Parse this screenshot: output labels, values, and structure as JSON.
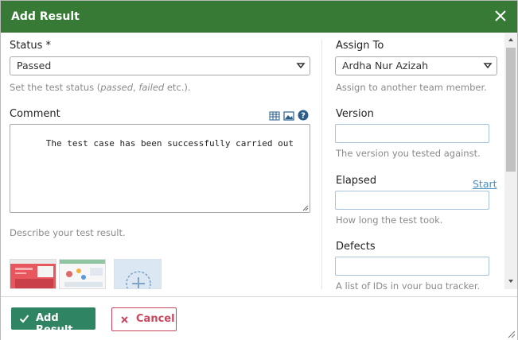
{
  "dialog": {
    "title": "Add Result",
    "close_icon": "close-icon"
  },
  "status": {
    "label": "Status *",
    "value": "Passed",
    "hint_prefix": "Set the test status (",
    "hint_em1": "passed",
    "hint_sep": ", ",
    "hint_em2": "failed",
    "hint_suffix": " etc.)."
  },
  "comment": {
    "label": "Comment",
    "value": "The test case has been successfully carried out",
    "hint": "Describe your test result.",
    "toolbar_icons": [
      "table-icon",
      "image-icon",
      "help-icon"
    ]
  },
  "attachments": {
    "items": [
      "attachment-thumbnail",
      "attachment-thumbnail"
    ],
    "add_icon": "add-attachment-icon"
  },
  "assign_to": {
    "label": "Assign To",
    "value": "Ardha Nur Azizah",
    "hint": "Assign to another team member."
  },
  "version": {
    "label": "Version",
    "value": "",
    "hint": "The version you tested against."
  },
  "elapsed": {
    "label": "Elapsed",
    "start_link": "Start",
    "value": "",
    "hint": "How long the test took."
  },
  "defects": {
    "label": "Defects",
    "value": "",
    "hint": "A list of IDs in your bug tracker."
  },
  "footer": {
    "add_result_label": "Add Result",
    "cancel_label": "Cancel"
  },
  "colors": {
    "titlebar": "#367a36",
    "primary_button": "#2f8463",
    "cancel": "#c9455d",
    "link": "#4a8fc1"
  }
}
